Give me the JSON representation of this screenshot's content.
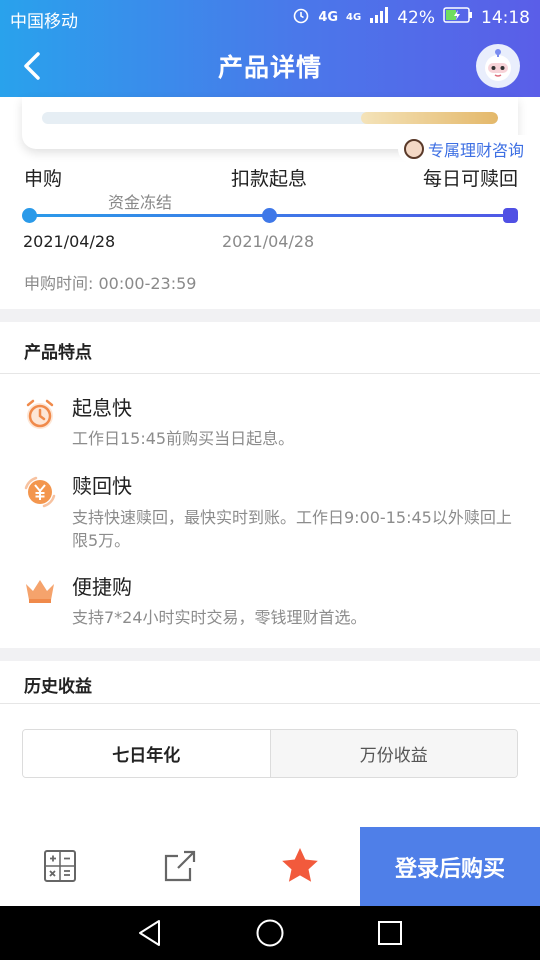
{
  "status_bar": {
    "carrier": "中国移动",
    "network_1": "4G",
    "network_2": "4G",
    "battery": "42%",
    "time": "14:18"
  },
  "nav": {
    "title": "产品详情"
  },
  "progress": {
    "fill_fraction": 0.3
  },
  "consult": {
    "label": "专属理财咨询"
  },
  "timeline": {
    "steps": [
      {
        "label": "申购",
        "date": "2021/04/28"
      },
      {
        "label": "扣款起息",
        "date": "2021/04/28"
      },
      {
        "label": "每日可赎回"
      }
    ],
    "freeze_label": "资金冻结",
    "subscribe_time": "申购时间: 00:00-23:59"
  },
  "features": {
    "title": "产品特点",
    "items": [
      {
        "icon": "alarm-clock-icon",
        "title": "起息快",
        "desc": "工作日15:45前购买当日起息。"
      },
      {
        "icon": "yen-refresh-icon",
        "title": "赎回快",
        "desc": "支持快速赎回，最快实时到账。工作日9:00-15:45以外赎回上限5万。"
      },
      {
        "icon": "crown-icon",
        "title": "便捷购",
        "desc": "支持7*24小时实时交易，零钱理财首选。"
      }
    ]
  },
  "history": {
    "title": "历史收益",
    "tabs": [
      "七日年化",
      "万份收益"
    ],
    "active_tab": 0
  },
  "bottom": {
    "buy_label": "登录后购买"
  },
  "colors": {
    "accent": "#4f7fe8",
    "header_start": "#29a2ec",
    "header_end": "#5a5ee8",
    "progress_gold": "#e4b86a",
    "icon_orange": "#f08a4b",
    "star_red": "#f25a3c"
  }
}
